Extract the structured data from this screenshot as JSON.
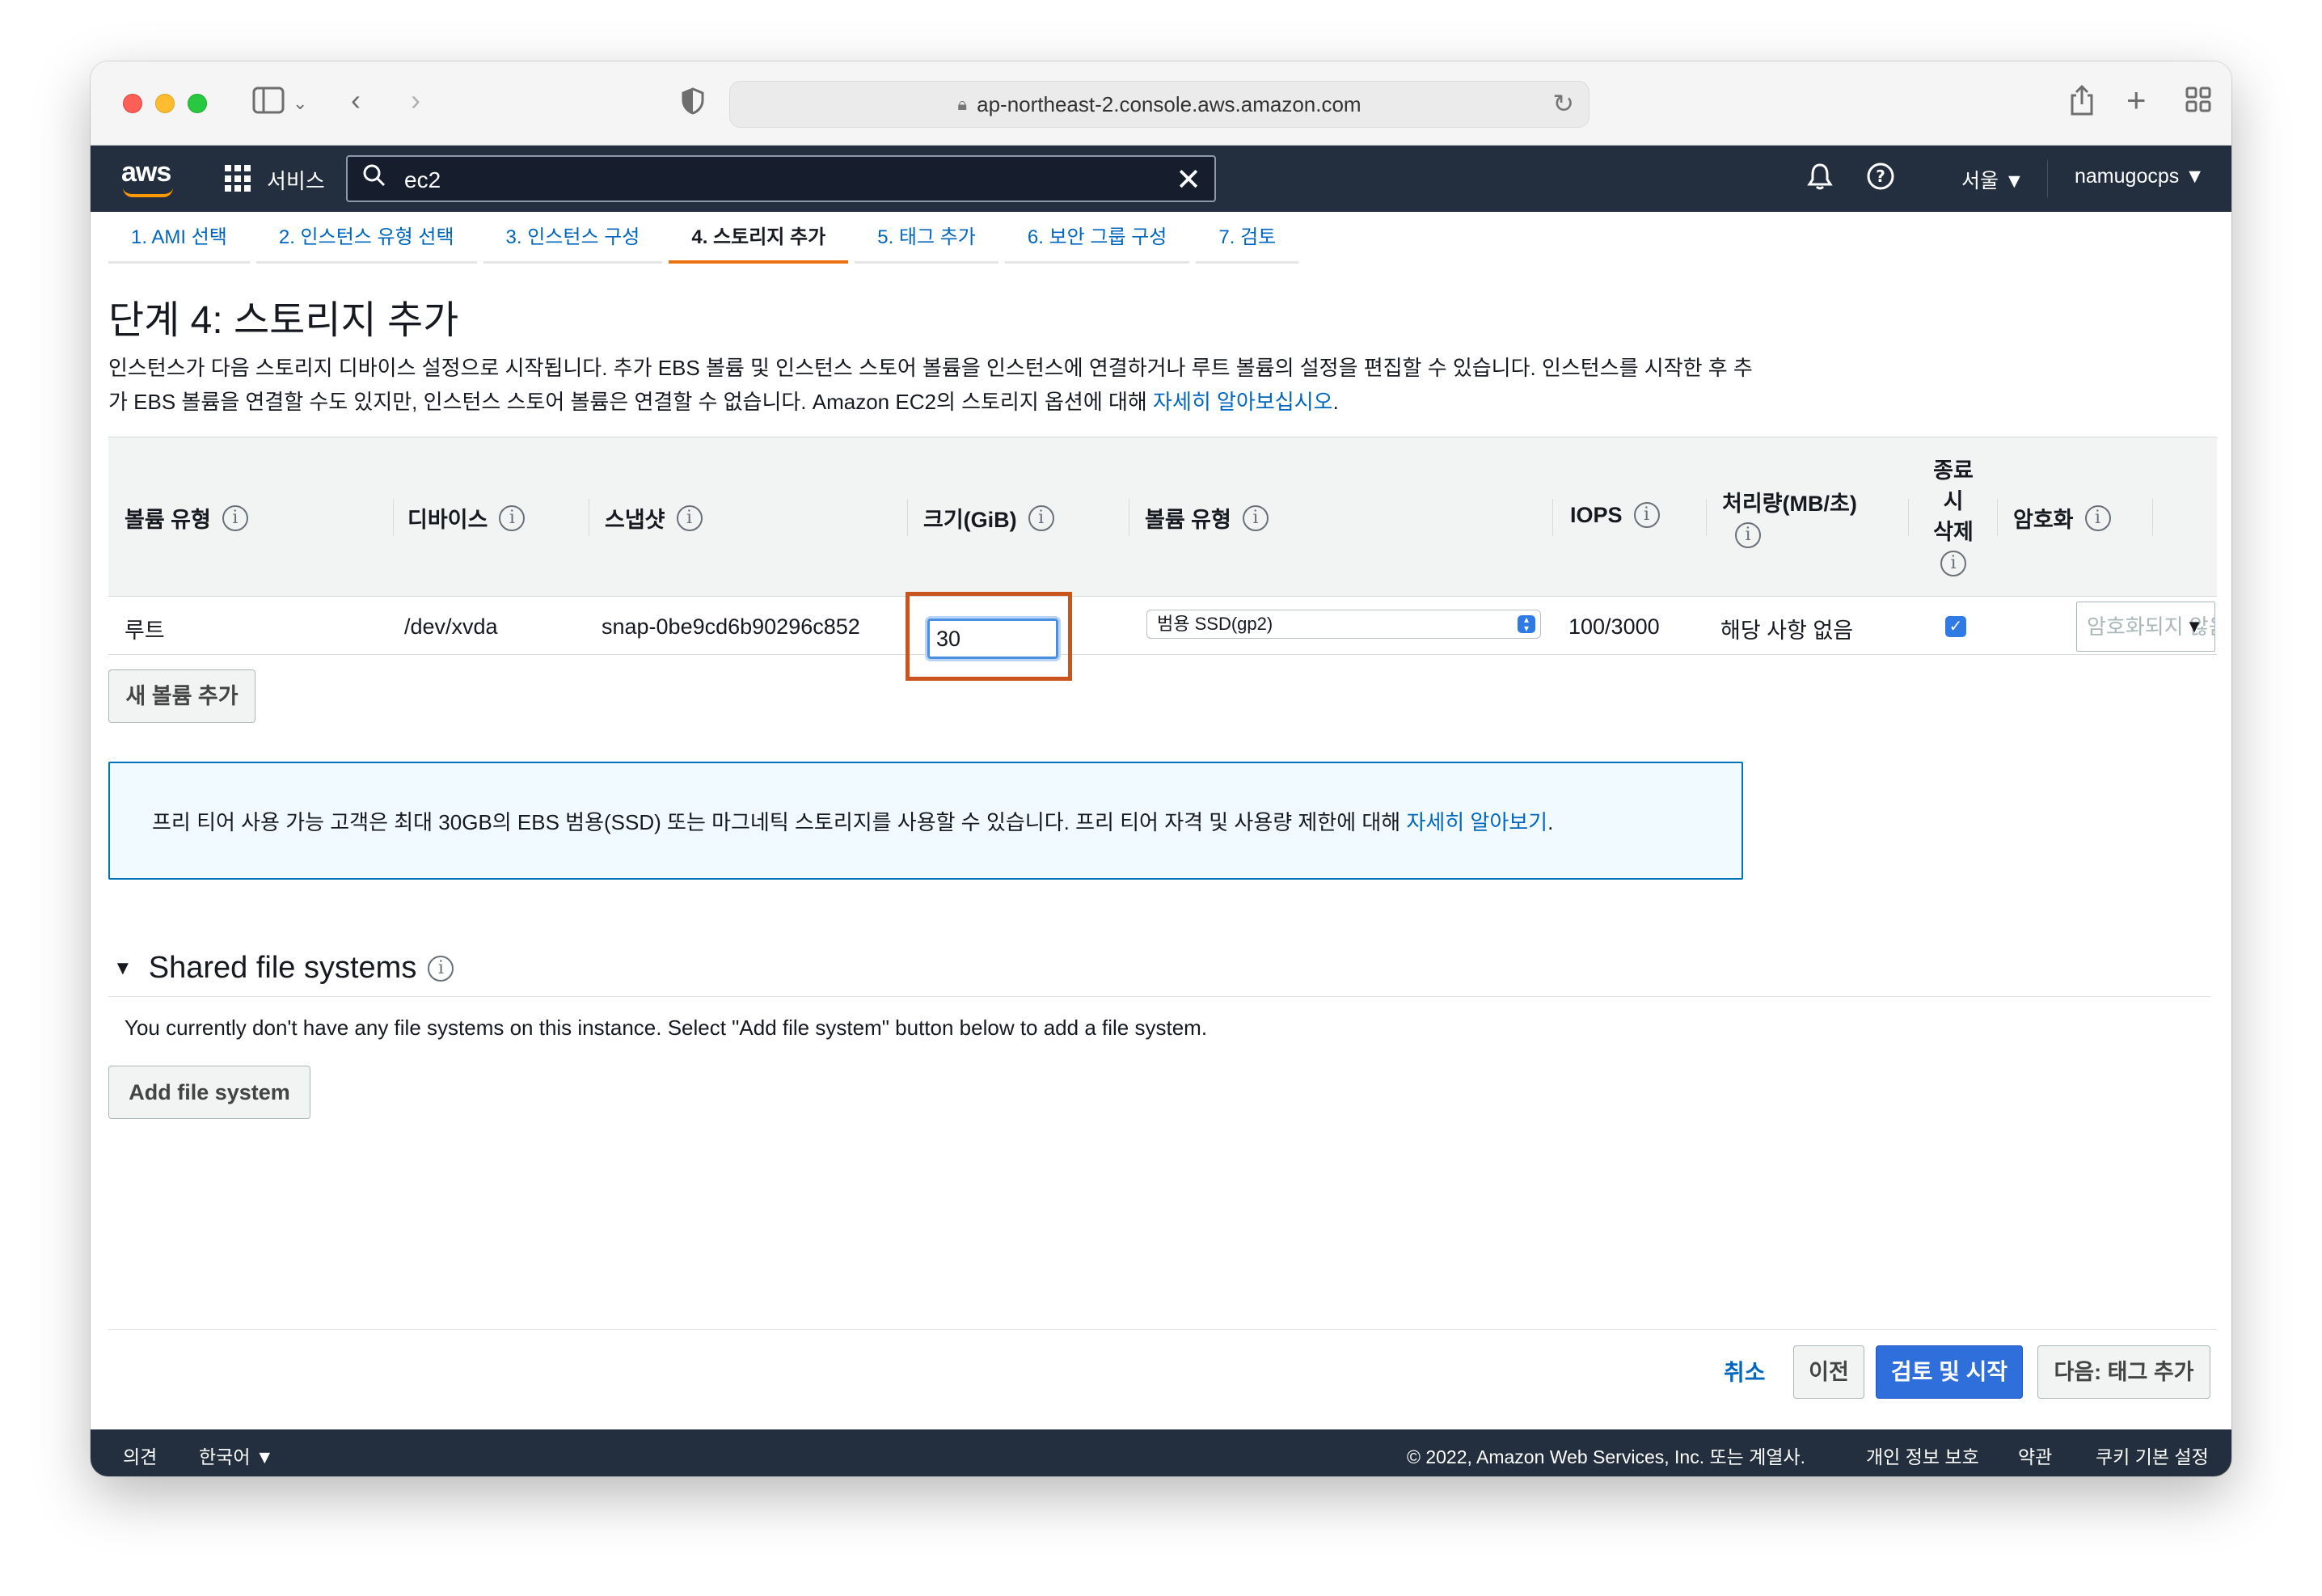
{
  "browser": {
    "url": "ap-northeast-2.console.aws.amazon.com"
  },
  "awsnav": {
    "logo_text": "aws",
    "services_label": "서비스",
    "search_value": "ec2",
    "region_label": "서울 ▼",
    "account_label": "namugocps ▼"
  },
  "wizard_tabs": [
    {
      "label": "1. AMI 선택"
    },
    {
      "label": "2. 인스턴스 유형 선택"
    },
    {
      "label": "3. 인스턴스 구성"
    },
    {
      "label": "4. 스토리지 추가"
    },
    {
      "label": "5. 태그 추가"
    },
    {
      "label": "6. 보안 그룹 구성"
    },
    {
      "label": "7. 검토"
    }
  ],
  "page": {
    "title": "단계 4: 스토리지 추가",
    "description": "인스턴스가 다음 스토리지 디바이스 설정으로 시작됩니다. 추가 EBS 볼륨 및 인스턴스 스토어 볼륨을 인스턴스에 연결하거나 루트 볼륨의 설정을 편집할 수 있습니다. 인스턴스를 시작한 후 추가 EBS 볼륨을 연결할 수도 있지만, 인스턴스 스토어 볼륨은 연결할 수 없습니다. Amazon EC2의 스토리지 옵션에 대해 ",
    "description_link": "자세히 알아보십시오",
    "description_end": "."
  },
  "table": {
    "headers": {
      "volume_kind": "볼륨 유형",
      "device": "디바이스",
      "snapshot": "스냅샷",
      "size": "크기(GiB)",
      "volume_type": "볼륨 유형",
      "iops": "IOPS",
      "throughput": "처리량(MB/초)",
      "delete_on_termination": "종료 시 삭제",
      "encryption": "암호화"
    },
    "row": {
      "volume_kind": "루트",
      "device": "/dev/xvda",
      "snapshot": "snap-0be9cd6b90296c852",
      "size": "30",
      "volume_type": "범용 SSD(gp2)",
      "iops": "100/3000",
      "throughput": "해당 사항 없음",
      "delete_on_termination": true,
      "encryption_placeholder": "암호화되지 않음"
    },
    "add_volume_label": "새 볼륨 추가"
  },
  "free_tier": {
    "text": "프리 티어 사용 가능 고객은 최대 30GB의 EBS 범용(SSD) 또는 마그네틱 스토리지를 사용할 수 있습니다. 프리 티어 자격 및 사용량 제한에 대해 ",
    "link": "자세히 알아보기",
    "end": "."
  },
  "file_systems": {
    "title": "Shared file systems",
    "empty_text": "You currently don't have any file systems on this instance. Select \"Add file system\" button below to add a file system.",
    "add_label": "Add file system"
  },
  "actions": {
    "cancel": "취소",
    "previous": "이전",
    "review_launch": "검토 및 시작",
    "next": "다음: 태그 추가"
  },
  "footer": {
    "feedback": "의견",
    "language": "한국어 ▼",
    "copyright": "© 2022, Amazon Web Services, Inc. 또는 계열사.",
    "privacy": "개인 정보 보호",
    "terms": "약관",
    "cookies": "쿠키 기본 설정"
  },
  "colors": {
    "nav_bg": "#232f3e",
    "accent_orange": "#ec7211",
    "highlight_box": "#c9541e",
    "link_blue": "#0066c0",
    "primary_button": "#2f6fdc"
  }
}
